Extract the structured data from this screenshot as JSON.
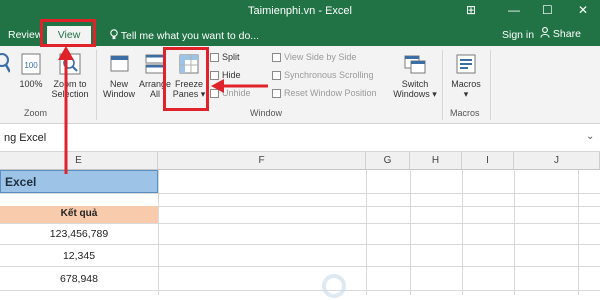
{
  "titlebar": {
    "title": "Taimienphi.vn - Excel",
    "controls": {
      "ribbon_options": "⊞",
      "minimize": "—",
      "maximize": "☐",
      "close": "✕"
    }
  },
  "menubar": {
    "tabs": {
      "review": "Review",
      "view": "View"
    },
    "tell_me": "Tell me what you want to do...",
    "sign_in": "Sign in",
    "share": "Share"
  },
  "ribbon": {
    "zoom_group": {
      "label": "Zoom",
      "zoom_100": "100%",
      "zoom_selection_line1": "Zoom to",
      "zoom_selection_line2": "Selection"
    },
    "window_group": {
      "label": "Window",
      "new_window_line1": "New",
      "new_window_line2": "Window",
      "arrange_line1": "Arrange",
      "arrange_line2": "All",
      "freeze_line1": "Freeze",
      "freeze_line2": "Panes ▾",
      "split": "Split",
      "hide": "Hide",
      "unhide": "Unhide",
      "view_side": "View Side by Side",
      "sync_scroll": "Synchronous Scrolling",
      "reset_pos": "Reset Window Position",
      "switch_line1": "Switch",
      "switch_line2": "Windows ▾"
    },
    "macros_group": {
      "label": "Macros",
      "macros_line1": "Macros",
      "macros_line2": "▾"
    }
  },
  "formula_bar": {
    "content": "ng Excel"
  },
  "grid": {
    "columns": [
      "E",
      "F",
      "G",
      "H",
      "I",
      "J"
    ],
    "excel_cell": "Excel",
    "result_header": "Kết quả",
    "values": [
      "123,456,789",
      "12,345",
      "678,948"
    ]
  },
  "colors": {
    "excel_green": "#217346",
    "highlight_red": "#e0232a",
    "header_blue": "#9dc3e6",
    "header_peach": "#f8cbad"
  }
}
